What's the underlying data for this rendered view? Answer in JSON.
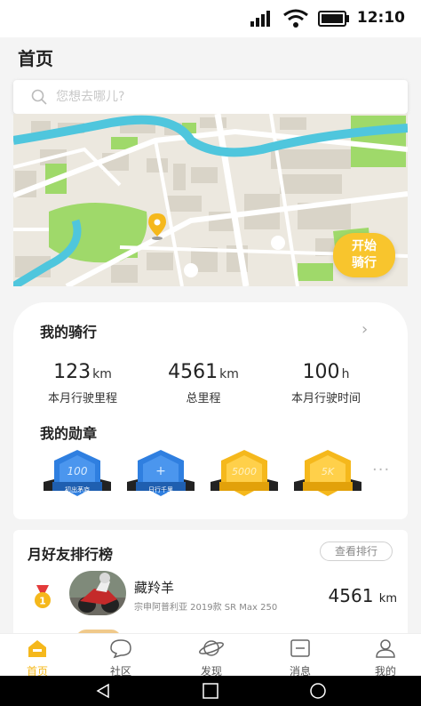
{
  "status_bar": {
    "time": "12:10"
  },
  "page_title": "首页",
  "search": {
    "placeholder": "您想去哪儿?"
  },
  "map": {
    "start_button": [
      "开始",
      "骑行"
    ]
  },
  "my_riding": {
    "title": "我的骑行",
    "stats": [
      {
        "value": "123",
        "unit": "km",
        "label": "本月行驶里程"
      },
      {
        "value": "4561",
        "unit": "km",
        "label": "总里程"
      },
      {
        "value": "100",
        "unit": "h",
        "label": "本月行驶时间"
      }
    ]
  },
  "badges": {
    "title": "我的勋章",
    "items": [
      {
        "number": "100",
        "text": "初出茅庐",
        "color": "#2f7fe0"
      },
      {
        "number": "+",
        "text": "日行千里",
        "color": "#2f7fe0"
      },
      {
        "number": "5000",
        "text": "",
        "color": "#f5b81c"
      },
      {
        "number": "5K",
        "text": "",
        "color": "#f5b81c"
      }
    ],
    "more": "···"
  },
  "ranking": {
    "title": "月好友排行榜",
    "button": "查看排行",
    "entries": [
      {
        "rank": "1",
        "name": "藏羚羊",
        "bike": "宗申阿普利亚 2019款 SR Max 250",
        "distance": "4561",
        "unit": "km"
      }
    ]
  },
  "tabs": [
    {
      "label": "首页",
      "icon": "home-icon",
      "active": true
    },
    {
      "label": "社区",
      "icon": "community-icon",
      "active": false
    },
    {
      "label": "发现",
      "icon": "planet-icon",
      "active": false
    },
    {
      "label": "消息",
      "icon": "message-icon",
      "active": false
    },
    {
      "label": "我的",
      "icon": "profile-icon",
      "active": false
    }
  ],
  "colors": {
    "accent": "#f5b81c",
    "map_water": "#4fc6dd",
    "map_park": "#9fd96a"
  }
}
